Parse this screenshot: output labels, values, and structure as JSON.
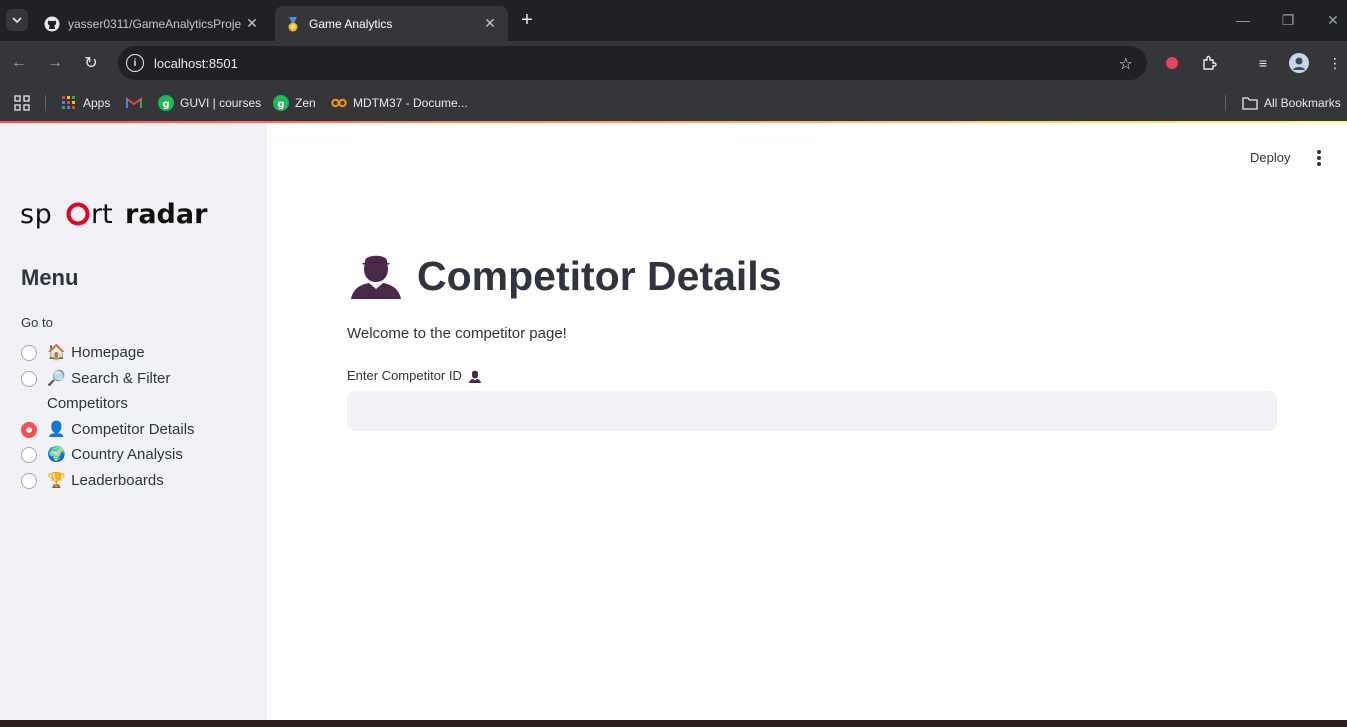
{
  "browser": {
    "tabs": [
      {
        "title": "yasser0311/GameAnalyticsProje",
        "favicon": "github-icon"
      },
      {
        "title": "Game Analytics",
        "favicon": "medal-icon"
      }
    ],
    "url": "localhost:8501",
    "bookmarks": [
      {
        "label": "Apps",
        "icon": "apps-grid-icon"
      },
      {
        "label": "",
        "icon": "gmail-icon"
      },
      {
        "label": "GUVI | courses",
        "icon": "guvi-icon"
      },
      {
        "label": "Zen",
        "icon": "guvi-icon"
      },
      {
        "label": "MDTM37 - Docume...",
        "icon": "infinity-icon"
      }
    ],
    "all_bookmarks_label": "All Bookmarks"
  },
  "sidebar": {
    "logo_alt": "sportradar",
    "menu_title": "Menu",
    "radio_label": "Go to",
    "options": [
      {
        "emoji": "🏠",
        "label": "Homepage",
        "checked": false
      },
      {
        "emoji": "🔎",
        "label": "Search & Filter Competitors",
        "checked": false
      },
      {
        "emoji": "👤",
        "label": "Competitor Details",
        "checked": true
      },
      {
        "emoji": "🌍",
        "label": "Country Analysis",
        "checked": false
      },
      {
        "emoji": "🏆",
        "label": "Leaderboards",
        "checked": false
      }
    ]
  },
  "header": {
    "deploy_label": "Deploy"
  },
  "main": {
    "title": "Competitor Details",
    "welcome": "Welcome to the competitor page!",
    "input_label": "Enter Competitor ID",
    "input_value": ""
  },
  "colors": {
    "accent": "#ff4b4b",
    "text": "#31333f",
    "sidebar_bg": "#f0f2f6"
  }
}
